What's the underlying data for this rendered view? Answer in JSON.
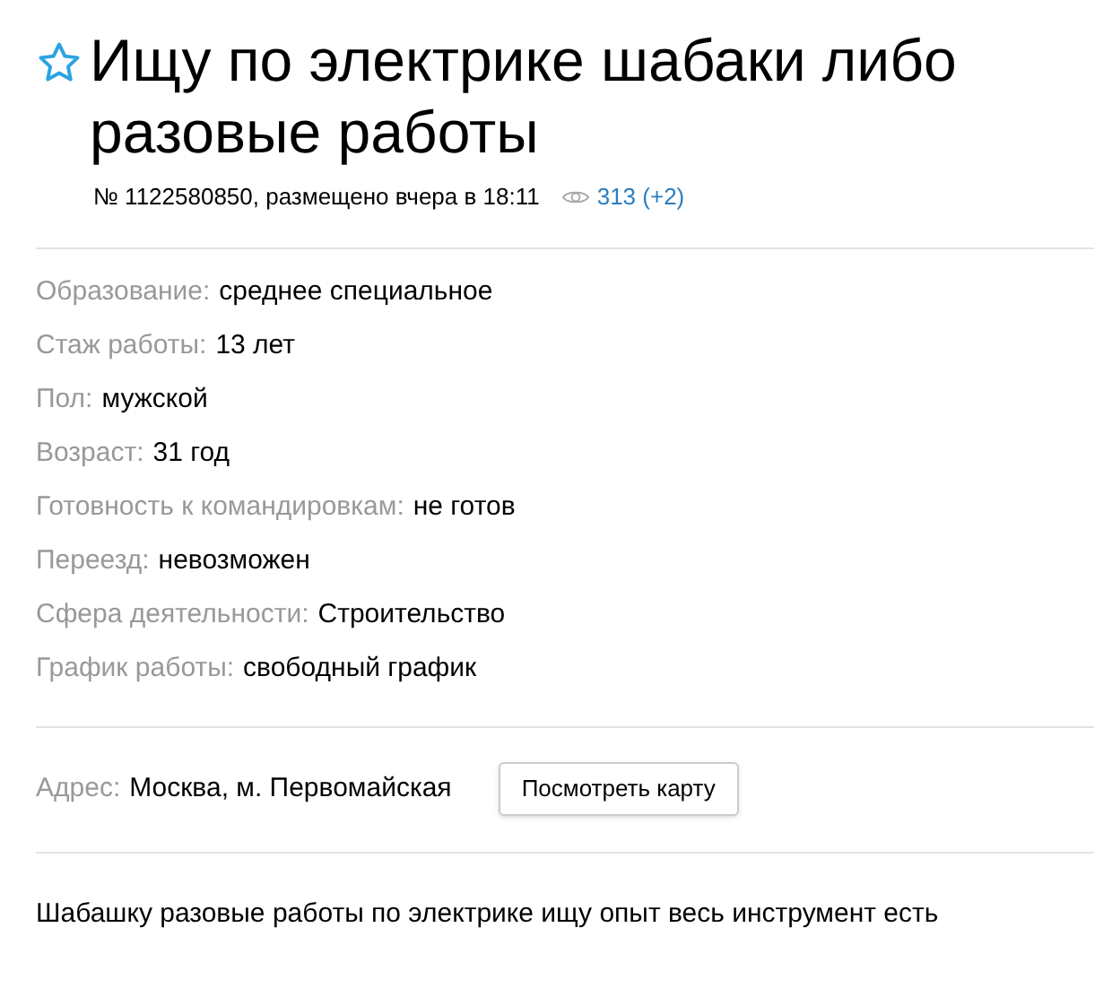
{
  "title": "Ищу по электрике шабаки либо разовые работы",
  "favorite": false,
  "meta": {
    "info": "№ 1122580850, размещено вчера в 18:11",
    "views": "313 (+2)"
  },
  "attributes": [
    {
      "label": "Образование:",
      "value": "среднее специальное"
    },
    {
      "label": "Стаж работы:",
      "value": "13 лет"
    },
    {
      "label": "Пол:",
      "value": "мужской"
    },
    {
      "label": "Возраст:",
      "value": "31 год"
    },
    {
      "label": "Готовность к командировкам:",
      "value": "не готов"
    },
    {
      "label": "Переезд:",
      "value": "невозможен"
    },
    {
      "label": "Сфера деятельности:",
      "value": "Строительство"
    },
    {
      "label": "График работы:",
      "value": "свободный график"
    }
  ],
  "address": {
    "label": "Адрес:",
    "value": "Москва, м. Первомайская",
    "button": "Посмотреть карту"
  },
  "description": "Шабашку разовые работы по электрике ищу опыт весь инструмент есть"
}
